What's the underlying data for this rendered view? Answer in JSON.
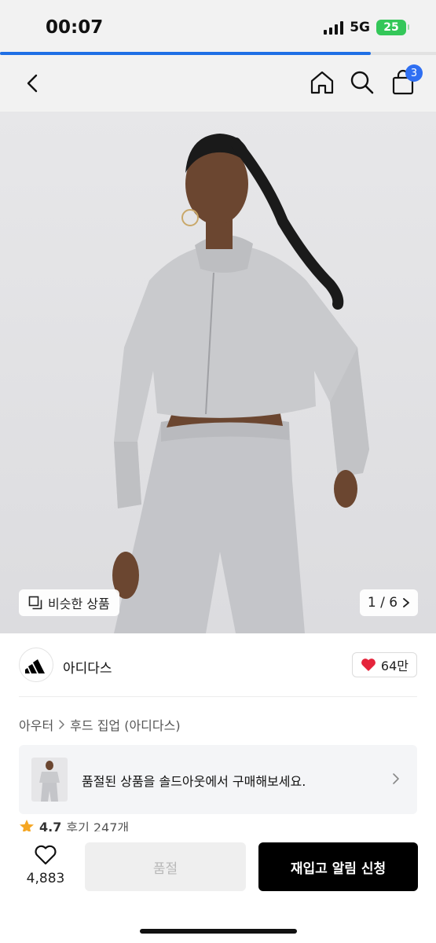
{
  "status_bar": {
    "time": "00:07",
    "network": "5G",
    "battery": "25"
  },
  "page_progress": 0.85,
  "nav": {
    "cart_count": "3",
    "icons": [
      "back-icon",
      "home-icon",
      "search-icon",
      "shopping-bag-icon"
    ]
  },
  "hero": {
    "similar_label": "비슷한 상품",
    "pager": "1 / 6"
  },
  "brand": {
    "name": "아디다스",
    "likes": "64만"
  },
  "breadcrumb": {
    "level1": "아우터",
    "level2": "후드 집업 (아디다스)"
  },
  "soldout_banner": {
    "text": "품절된 상품을 솔드아웃에서 구매해보세요."
  },
  "rating": {
    "score": "4.7",
    "reviews": "후기 247개"
  },
  "bottom_bar": {
    "wish_count": "4,883",
    "soldout_label": "품절",
    "restock_label": "재입고 알림 신청"
  },
  "colors": {
    "accent_blue": "#1f6fe5",
    "heart_red": "#e5243b",
    "cta_black": "#000000",
    "battery_green": "#34c759"
  }
}
